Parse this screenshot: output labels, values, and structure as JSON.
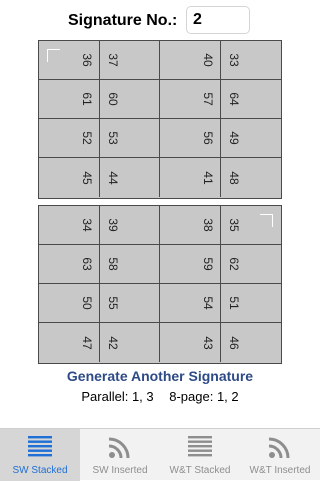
{
  "header": {
    "label": "Signature No.:",
    "value": "2"
  },
  "grid1": {
    "rows": [
      {
        "left": [
          "36",
          "37"
        ],
        "right": [
          "40",
          "33"
        ]
      },
      {
        "left": [
          "61",
          "60"
        ],
        "right": [
          "57",
          "64"
        ]
      },
      {
        "left": [
          "52",
          "53"
        ],
        "right": [
          "56",
          "49"
        ]
      },
      {
        "left": [
          "45",
          "44"
        ],
        "right": [
          "41",
          "48"
        ]
      }
    ]
  },
  "grid2": {
    "rows": [
      {
        "left": [
          "34",
          "39"
        ],
        "right": [
          "38",
          "35"
        ]
      },
      {
        "left": [
          "63",
          "58"
        ],
        "right": [
          "59",
          "62"
        ]
      },
      {
        "left": [
          "50",
          "55"
        ],
        "right": [
          "54",
          "51"
        ]
      },
      {
        "left": [
          "47",
          "42"
        ],
        "right": [
          "43",
          "46"
        ]
      }
    ]
  },
  "actions": {
    "generate_label": "Generate Another Signature"
  },
  "info": {
    "parallel": "Parallel: 1, 3",
    "eight_page": "8-page: 1, 2"
  },
  "tabs": [
    {
      "label": "SW Stacked",
      "icon": "stacked-lines-icon",
      "active": true
    },
    {
      "label": "SW Inserted",
      "icon": "inserted-arcs-icon",
      "active": false
    },
    {
      "label": "W&T Stacked",
      "icon": "stacked-lines-icon",
      "active": false
    },
    {
      "label": "W&T Inserted",
      "icon": "inserted-arcs-icon",
      "active": false
    }
  ],
  "colors": {
    "accent": "#1e6fd6",
    "link": "#2e4a86",
    "cell": "#c8c8c8"
  }
}
